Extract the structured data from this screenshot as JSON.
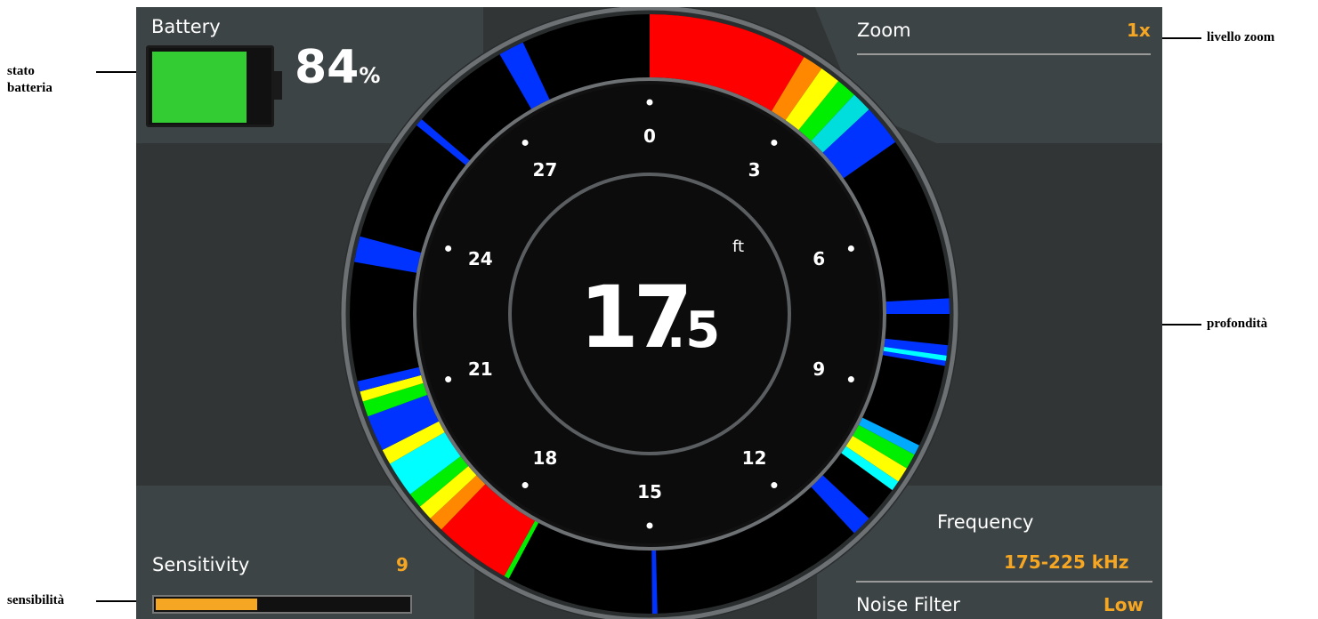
{
  "battery": {
    "label": "Battery",
    "level_percent": 84,
    "value": "84",
    "unit": "%"
  },
  "zoom": {
    "label": "Zoom",
    "value": "1x"
  },
  "sensitivity": {
    "label": "Sensitivity",
    "value": "9",
    "level_fraction": 0.4
  },
  "frequency": {
    "label": "Frequency",
    "value": "175-225 kHz"
  },
  "noise_filter": {
    "label": "Noise Filter",
    "value": "Low"
  },
  "depth": {
    "integer": "17",
    "decimal": ".5",
    "unit": "ft"
  },
  "dial_ticks": [
    "0",
    "3",
    "6",
    "9",
    "12",
    "15",
    "18",
    "21",
    "24",
    "27"
  ],
  "annotations": {
    "battery": "stato batteria",
    "zoom": "livello zoom",
    "depth": "profondità",
    "sensitivity": "sensibilità"
  },
  "colors": {
    "background": "#323536",
    "panel": "#3d4446",
    "accent": "#f5a623",
    "battery_fill": "#33cc33",
    "sonar_strong": "#ff0000",
    "sonar_weak": "#0033ff"
  }
}
